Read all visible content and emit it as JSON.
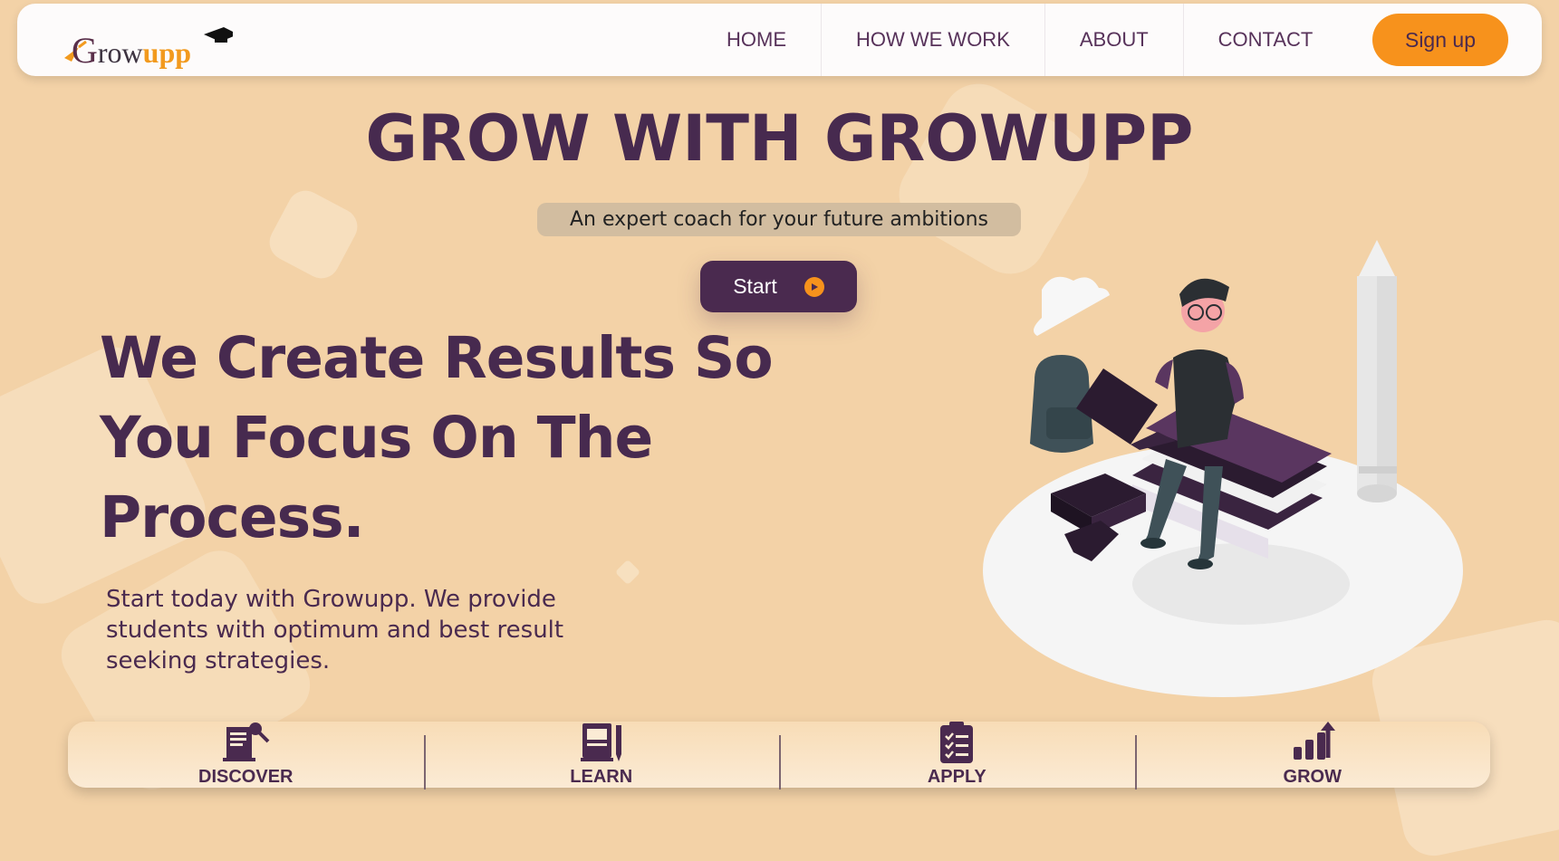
{
  "nav": {
    "logo": {
      "g": "G",
      "row": "row",
      "upp": "upp"
    },
    "links": [
      "HOME",
      "HOW WE WORK",
      "ABOUT",
      "CONTACT"
    ],
    "signup_label": "Sign up"
  },
  "hero": {
    "title": "GROW WITH GROWUPP",
    "tagline": "An expert coach for your future ambitions",
    "start_label": "Start",
    "headline": "We Create Results So You Focus On The Process.",
    "description": "Start today with Growupp. We provide students with optimum and best result seeking strategies."
  },
  "steps": [
    {
      "label": "DISCOVER",
      "icon": "discover-icon"
    },
    {
      "label": "LEARN",
      "icon": "book-icon"
    },
    {
      "label": "APPLY",
      "icon": "clipboard-icon"
    },
    {
      "label": "GROW",
      "icon": "growth-chart-icon"
    }
  ],
  "colors": {
    "background": "#f3d2a7",
    "primary": "#4a2a4f",
    "accent": "#f7921c",
    "navbar": "#fdfbfb"
  }
}
